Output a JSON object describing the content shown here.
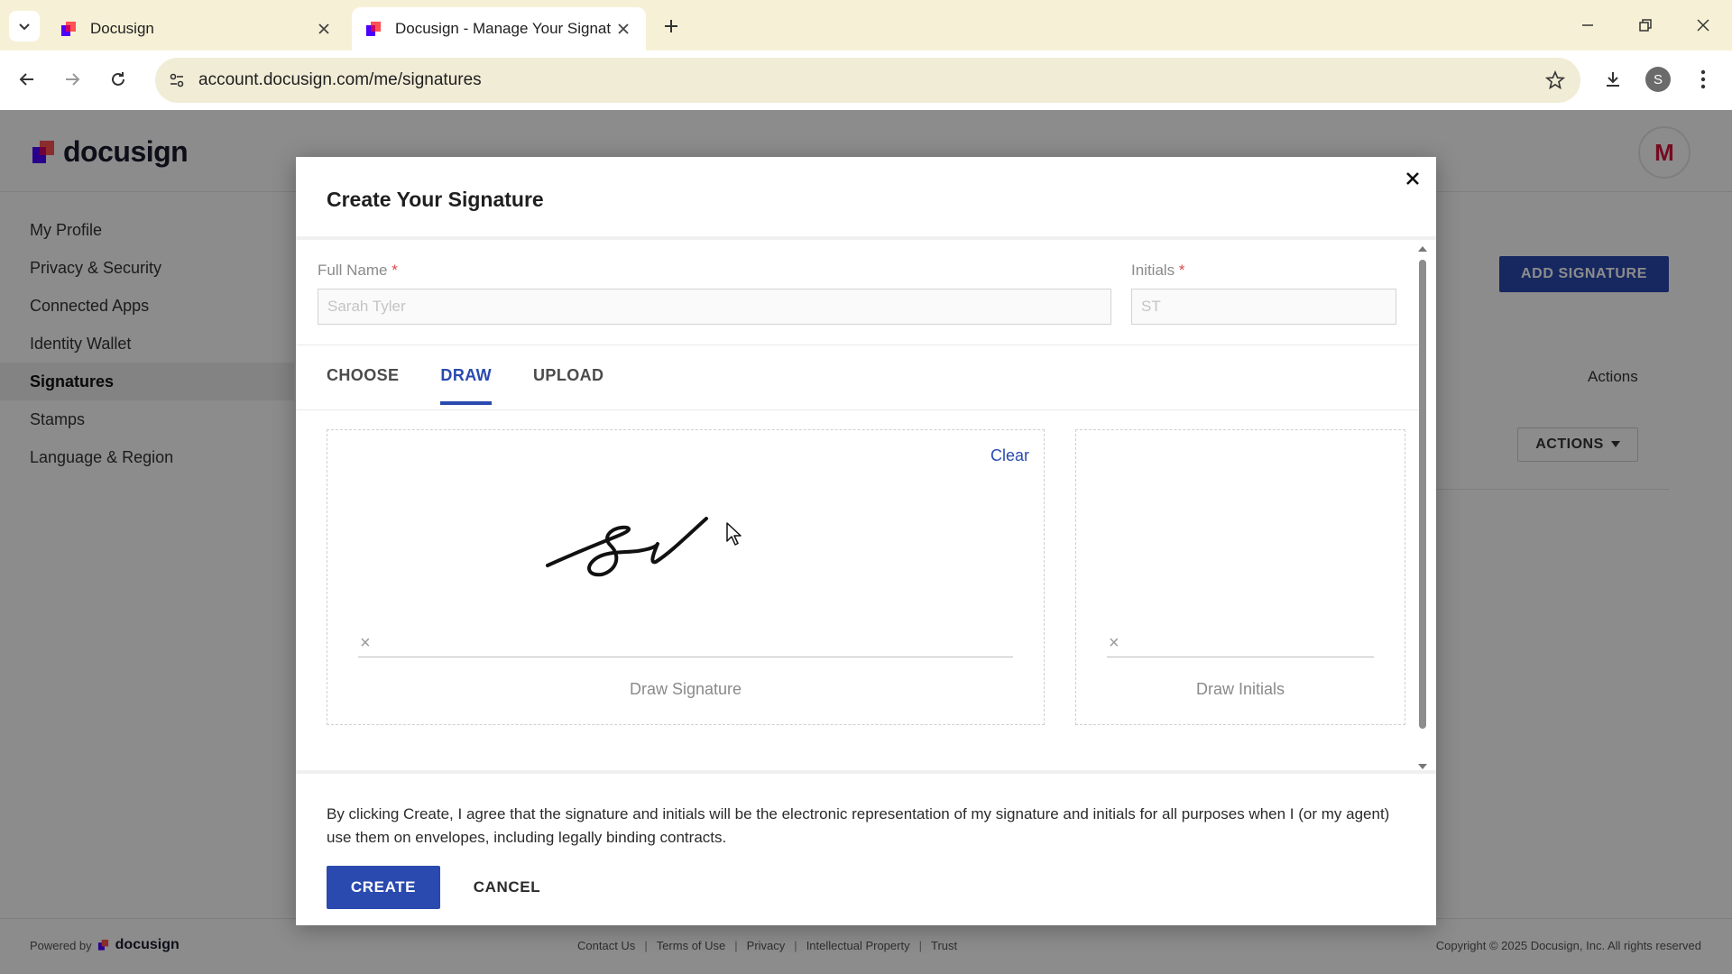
{
  "browser": {
    "tabs": [
      {
        "title": "Docusign",
        "active": false
      },
      {
        "title": "Docusign - Manage Your Signat",
        "active": true
      }
    ],
    "url": "account.docusign.com/me/signatures",
    "profile_initial": "S",
    "accent": "#f6f1d6"
  },
  "page": {
    "brand": "docusign",
    "avatar_initial": "M",
    "sidebar": [
      {
        "label": "My Profile",
        "active": false
      },
      {
        "label": "Privacy & Security",
        "active": false
      },
      {
        "label": "Connected Apps",
        "active": false
      },
      {
        "label": "Identity Wallet",
        "active": false
      },
      {
        "label": "Signatures",
        "active": true
      },
      {
        "label": "Stamps",
        "active": false
      },
      {
        "label": "Language & Region",
        "active": false
      }
    ],
    "add_signature": "ADD SIGNATURE",
    "actions_header": "Actions",
    "actions_button": "ACTIONS",
    "footer": {
      "powered_by": "Powered by",
      "powered_brand": "docusign",
      "links": [
        "Contact Us",
        "Terms of Use",
        "Privacy",
        "Intellectual Property",
        "Trust"
      ],
      "copyright": "Copyright © 2025 Docusign, Inc. All rights reserved"
    }
  },
  "modal": {
    "title": "Create Your Signature",
    "full_name_label": "Full Name",
    "full_name_value": "Sarah Tyler",
    "initials_label": "Initials",
    "initials_value": "ST",
    "required_mark": "*",
    "tabs": [
      {
        "label": "CHOOSE",
        "active": false
      },
      {
        "label": "DRAW",
        "active": true
      },
      {
        "label": "UPLOAD",
        "active": false
      }
    ],
    "clear": "Clear",
    "pad_x": "×",
    "draw_signature": "Draw Signature",
    "draw_initials": "Draw Initials",
    "legal": "By clicking Create, I agree that the signature and initials will be the electronic representation of my signature and initials for all purposes when I (or my agent) use them on envelopes, including legally binding contracts.",
    "create": "CREATE",
    "cancel": "CANCEL",
    "brand_color": "#2a4aaf"
  }
}
